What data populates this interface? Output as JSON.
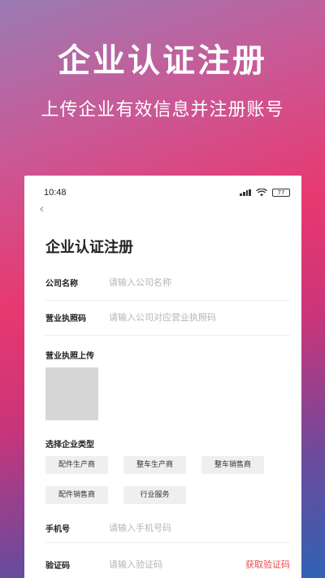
{
  "promo": {
    "title": "企业认证注册",
    "subtitle": "上传企业有效信息并注册账号"
  },
  "status_bar": {
    "time": "10:48",
    "battery": "77"
  },
  "page": {
    "title": "企业认证注册"
  },
  "form": {
    "company_name": {
      "label": "公司名称",
      "placeholder": "请输入公司名称"
    },
    "license_code": {
      "label": "营业执照码",
      "placeholder": "请输入公司对应营业执照码"
    },
    "license_upload": {
      "label": "营业执照上传"
    },
    "company_type": {
      "label": "选择企业类型",
      "options": [
        "配件生产商",
        "整车生产商",
        "整车销售商",
        "配件销售商",
        "行业服务"
      ]
    },
    "phone": {
      "label": "手机号",
      "placeholder": "请输入手机号码"
    },
    "verify_code": {
      "label": "验证码",
      "placeholder": "请输入验证码",
      "button": "获取验证码"
    }
  },
  "icons": {
    "back": "chevron-left-icon",
    "signal": "signal-icon",
    "wifi": "wifi-icon",
    "battery": "battery-icon"
  }
}
